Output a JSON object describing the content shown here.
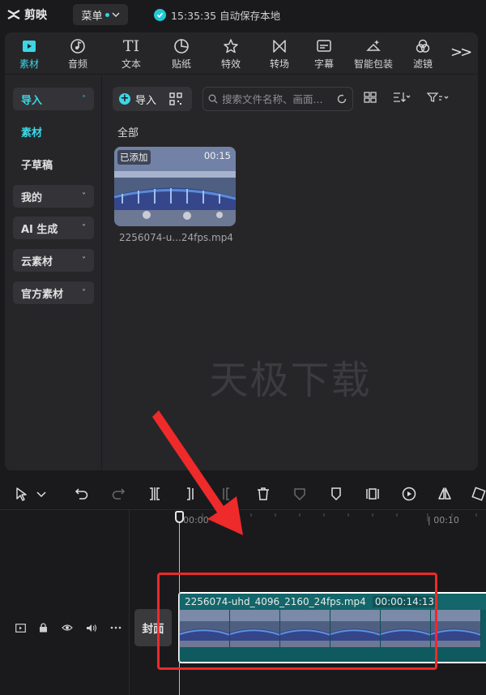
{
  "app": {
    "name": "剪映",
    "menu_label": "菜单",
    "save_status": "15:35:35 自动保存本地"
  },
  "toolbar": {
    "items": [
      {
        "label": "素材",
        "icon": "media-icon",
        "active": true
      },
      {
        "label": "音频",
        "icon": "audio-icon"
      },
      {
        "label": "文本",
        "icon": "text-icon"
      },
      {
        "label": "贴纸",
        "icon": "sticker-icon"
      },
      {
        "label": "特效",
        "icon": "effects-icon"
      },
      {
        "label": "转场",
        "icon": "transition-icon"
      },
      {
        "label": "字幕",
        "icon": "subtitle-icon"
      },
      {
        "label": "智能包装",
        "icon": "smart-package-icon"
      },
      {
        "label": "滤镜",
        "icon": "filter-icon"
      }
    ],
    "more_label": ">>"
  },
  "sidebar": {
    "items": [
      {
        "label": "导入",
        "chevron": "up"
      },
      {
        "label": "素材"
      },
      {
        "label": "子草稿"
      },
      {
        "label": "我的",
        "chevron": "down"
      },
      {
        "label": "AI 生成",
        "chevron": "down"
      },
      {
        "label": "云素材",
        "chevron": "down"
      },
      {
        "label": "官方素材",
        "chevron": "down"
      }
    ]
  },
  "content": {
    "import_label": "导入",
    "search_placeholder": "搜索文件名称、画面...",
    "section_title": "全部",
    "media": {
      "tag": "已添加",
      "duration": "00:15",
      "filename": "2256074-u...24fps.mp4"
    },
    "watermark": "天极下载"
  },
  "timeline": {
    "ruler_labels": [
      "00:00",
      "| 00:10"
    ],
    "cover_label": "封面",
    "clip": {
      "name": "2256074-uhd_4096_2160_24fps.mp4",
      "duration": "00:00:14:13"
    }
  },
  "colors": {
    "accent": "#3cd7e6",
    "panel": "#262629",
    "background": "#1a1a1c",
    "clip": "#0f5a5e",
    "highlight": "#ee2a2a"
  }
}
